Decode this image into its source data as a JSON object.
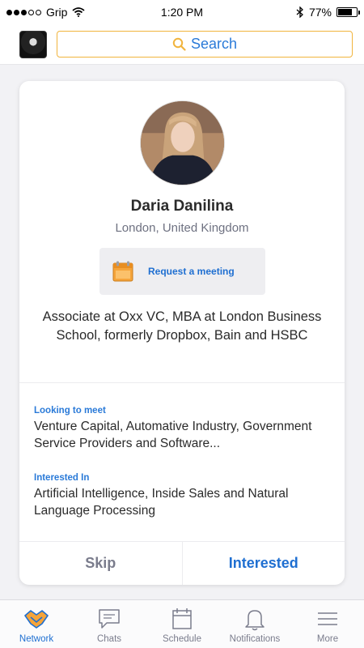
{
  "status_bar": {
    "carrier": "Grip",
    "time": "1:20 PM",
    "battery": "77%",
    "battery_level": 0.77
  },
  "header": {
    "search_label": "Search"
  },
  "profile": {
    "name": "Daria Danilina",
    "location": "London, United Kingdom",
    "meeting_label": "Request a meeting",
    "headline": "Associate at Oxx VC, MBA at London Business School, formerly Dropbox, Bain and HSBC",
    "looking_label": "Looking to meet",
    "looking_text": "Venture Capital, Automative Industry, Government Service Providers and Software...",
    "interested_label": "Interested In",
    "interested_text": "Artificial Intelligence, Inside Sales and Natural Language Processing"
  },
  "actions": {
    "skip": "Skip",
    "interested": "Interested"
  },
  "tabs": [
    {
      "label": "Network",
      "icon": "handshake-icon",
      "active": true
    },
    {
      "label": "Chats",
      "icon": "chat-icon",
      "active": false
    },
    {
      "label": "Schedule",
      "icon": "calendar-icon",
      "active": false
    },
    {
      "label": "Notifications",
      "icon": "bell-icon",
      "active": false
    },
    {
      "label": "More",
      "icon": "menu-icon",
      "active": false
    }
  ],
  "colors": {
    "accent_blue": "#1f6fd1",
    "search_border": "#f1b43d",
    "calendar_orange": "#f5a43a"
  }
}
